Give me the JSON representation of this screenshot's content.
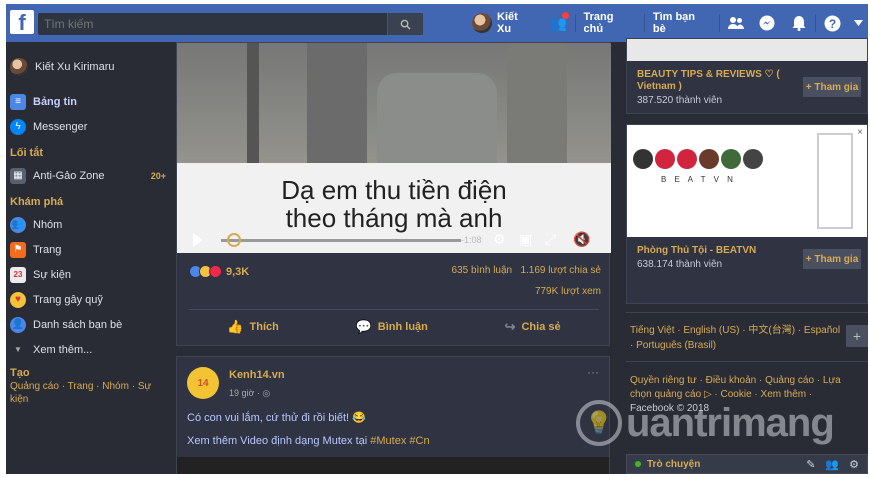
{
  "topbar": {
    "search_placeholder": "Tìm kiếm",
    "user_name": "Kiết Xu",
    "nav_home": "Trang chủ",
    "nav_find_friends": "Tìm bạn bè"
  },
  "sidebar": {
    "profile_name": "Kiết Xu Kirimaru",
    "items": [
      {
        "label": "Bảng tin",
        "icon": "newsfeed-icon"
      },
      {
        "label": "Messenger",
        "icon": "messenger-icon"
      }
    ],
    "shortcuts_heading": "Lối tắt",
    "shortcut": {
      "label": "Anti-Gảo Zone",
      "count": "20+"
    },
    "explore_heading": "Khám phá",
    "explore": [
      {
        "label": "Nhóm",
        "icon": "groups-icon"
      },
      {
        "label": "Trang",
        "icon": "pages-flag-icon"
      },
      {
        "label": "Sự kiện",
        "icon": "calendar-icon"
      },
      {
        "label": "Trang gây quỹ",
        "icon": "fundraiser-icon"
      },
      {
        "label": "Danh sách bạn bè",
        "icon": "friends-list-icon"
      }
    ],
    "see_more": "Xem thêm...",
    "create_heading": "Tạo",
    "create_links": "Quảng cáo · Trang · Nhóm · Sự kiện"
  },
  "post1": {
    "caption_line1": "Dạ em thu tiền điện",
    "caption_line2": "theo tháng mà anh",
    "video_time": "-1:08",
    "reaction_count": "9,3K",
    "comments": "635 bình luận",
    "shares": "1.169 lượt chia sẻ",
    "views": "779K lượt xem",
    "like_label": "Thích",
    "comment_label": "Bình luận",
    "share_label": "Chia sẻ"
  },
  "post2": {
    "page_name": "Kenh14.vn",
    "time": "19 giờ · ",
    "logo_text": "14",
    "text_line1": "Có con vui lắm, cứ thử đi rồi biết! 😂",
    "text_line2_prefix": "Xem thêm Video định dạng Mutex tại ",
    "text_line2_tags": "#Mutex #Cn"
  },
  "right": {
    "group1": {
      "title": "BEAUTY TIPS & REVIEWS ♡ ( Vietnam )",
      "members": "387.520 thành viên"
    },
    "group2": {
      "title": "Phòng Thủ Tội - BEATVN",
      "members": "638.174 thành viên",
      "banner_text": "B E A T V N"
    },
    "join_label": "+ Tham gia",
    "languages": "Tiếng Việt · English (US) · 中文(台灣) · Español · Português (Brasil)",
    "footer_links": "Quyền riêng tư · Điều khoản · Quảng cáo · Lựa chọn quảng cáo ▷ · Cookie · Xem thêm ·",
    "copyright": "Facebook © 2018",
    "chat_label": "Trò chuyện"
  },
  "watermark": {
    "text": "uantrimang"
  },
  "colors": {
    "topbar": "#4267b2",
    "accent": "#d7ab52",
    "background": "#2a2c35"
  }
}
